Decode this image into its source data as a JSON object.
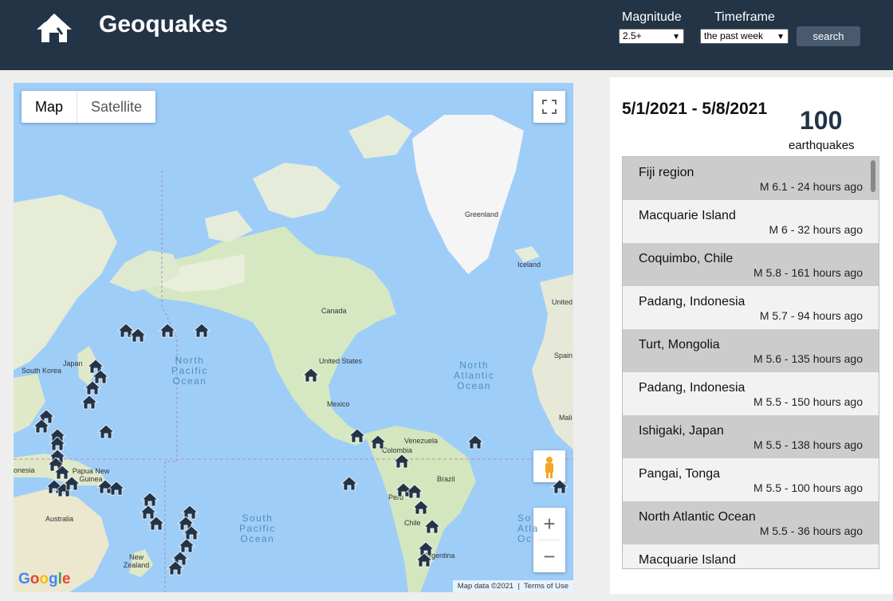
{
  "header": {
    "title": "Geoquakes",
    "magnitude_label": "Magnitude",
    "magnitude_value": "2.5+",
    "timeframe_label": "Timeframe",
    "timeframe_value": "the past week",
    "search_label": "search",
    "logo_icon": "house-quake-icon",
    "bg_color": "#243447"
  },
  "map": {
    "type_map": "Map",
    "type_satellite": "Satellite",
    "labels": [
      "Greenland",
      "Iceland",
      "Canada",
      "United States",
      "Mexico",
      "Venezuela",
      "Colombia",
      "Brazil",
      "Chile",
      "Argentina",
      "Australia",
      "New Zealand",
      "Papua New Guinea",
      "South Korea",
      "Japan",
      "United Kingdom",
      "Spain",
      "Mali",
      "Peru",
      "onesia"
    ],
    "oceans": [
      "North\nPacific\nOcean",
      "North\nAtlantic\nOcean",
      "South\nPacific\nOcean",
      "So\nAtla\nOc"
    ],
    "google": "Google",
    "map_data": "Map data ©2021",
    "terms": "Terms of Use",
    "zoom_in": "+",
    "zoom_out": "−"
  },
  "sidebar": {
    "date_range": "5/1/2021 - 5/8/2021",
    "count": "100",
    "count_label": "earthquakes",
    "quakes": [
      {
        "place": "Fiji region",
        "meta": "M 6.1 - 24 hours ago"
      },
      {
        "place": "Macquarie Island",
        "meta": "M 6 - 32 hours ago"
      },
      {
        "place": "Coquimbo, Chile",
        "meta": "M 5.8 - 161 hours ago"
      },
      {
        "place": "Padang, Indonesia",
        "meta": "M 5.7 - 94 hours ago"
      },
      {
        "place": "Turt, Mongolia",
        "meta": "M 5.6 - 135 hours ago"
      },
      {
        "place": "Padang, Indonesia",
        "meta": "M 5.5 - 150 hours ago"
      },
      {
        "place": "Ishigaki, Japan",
        "meta": "M 5.5 - 138 hours ago"
      },
      {
        "place": "Pangai, Tonga",
        "meta": "M 5.5 - 100 hours ago"
      },
      {
        "place": "North Atlantic Ocean",
        "meta": "M 5.5 - 36 hours ago"
      },
      {
        "place": "Macquarie Island",
        "meta": ""
      }
    ]
  }
}
